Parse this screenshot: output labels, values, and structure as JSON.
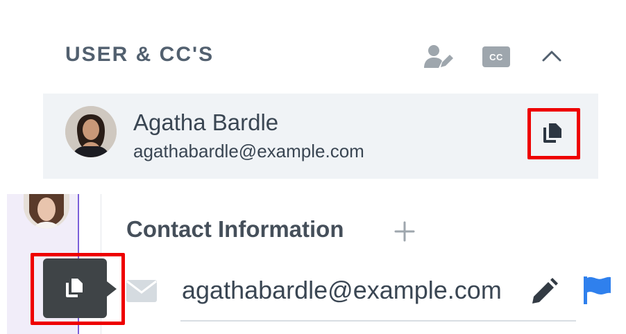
{
  "users_panel": {
    "title": "USER & CC'S",
    "cc_label": "CC",
    "user": {
      "name": "Agatha Bardle",
      "email": "agathabardle@example.com"
    }
  },
  "contact_panel": {
    "title": "Contact Information",
    "add_symbol": "+",
    "email_value": "agathabardle@example.com"
  },
  "icons": {
    "header": [
      "user-edit-icon",
      "cc-icon",
      "chevron-up-icon"
    ],
    "user_row": [
      "copy-icon"
    ],
    "contact": [
      "plus-icon",
      "copy-icon",
      "mail-icon",
      "pencil-icon",
      "flag-icon"
    ]
  },
  "colors": {
    "title_text": "#52606f",
    "row_background": "#f0f3f6",
    "highlight_box": "#ee0000",
    "tooltip_background": "#3f4447",
    "flag_blue": "#2f80ed",
    "rail_divider": "#7b5fd9",
    "rail_background": "#f1edf9"
  }
}
